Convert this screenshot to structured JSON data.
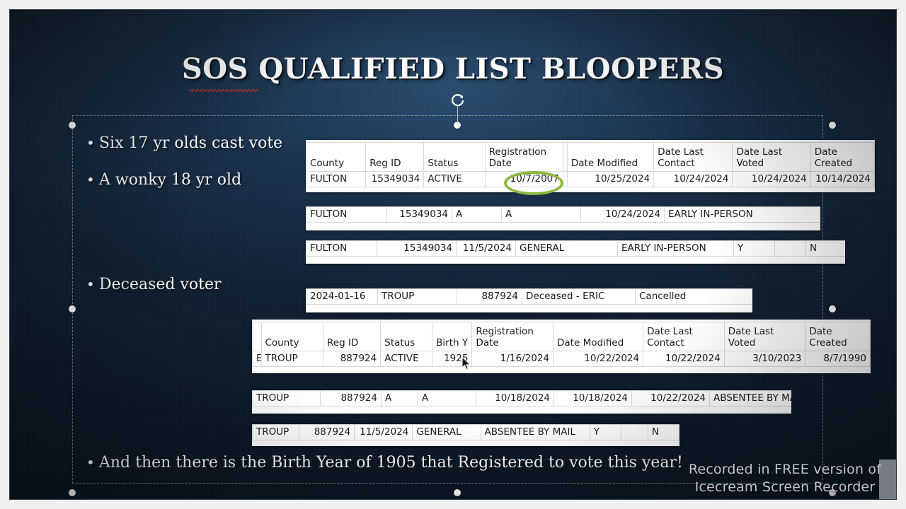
{
  "slide": {
    "title": "SOS QUALIFIED LIST BLOOPERS",
    "bullets": [
      {
        "text": "Six 17 yr olds cast vote"
      },
      {
        "text": "A wonky 18 yr old"
      },
      {
        "text": "Deceased voter"
      },
      {
        "text": "And then there is the Birth Year of 1905 that Registered to vote this year!"
      }
    ],
    "background_color": "#12202f",
    "title_color": "#ffffff",
    "highlight_color": "#8cb83c"
  },
  "sheet1": {
    "headers": [
      "County",
      "Reg ID",
      "Status",
      "Registration Date",
      "",
      "Date Modified",
      "Date Last Contact",
      "Date Last Voted",
      "Date Created"
    ],
    "row": [
      "FULTON",
      "15349034",
      "ACTIVE",
      "10/7/2007",
      "",
      "10/25/2024",
      "10/24/2024",
      "10/24/2024",
      "10/14/2024"
    ]
  },
  "sheet2": {
    "row": [
      "FULTON",
      "15349034",
      "A",
      "A",
      "10/24/2024",
      "EARLY IN-PERSON"
    ]
  },
  "sheet3": {
    "row": [
      "FULTON",
      "15349034",
      "11/5/2024",
      "GENERAL",
      "EARLY IN-PERSON",
      "Y",
      "",
      "N"
    ]
  },
  "sheet4": {
    "row": [
      "2024-01-16",
      "TROUP",
      "887924",
      "Deceased - ERIC",
      "Cancelled"
    ]
  },
  "sheet5": {
    "headers": [
      "",
      "County",
      "Reg ID",
      "Status",
      "Birth Y",
      "Registration Date",
      "Date Modified",
      "Date Last Contact",
      "Date Last Voted",
      "Date Created"
    ],
    "row": [
      "E",
      "TROUP",
      "887924",
      "ACTIVE",
      "1925",
      "1/16/2024",
      "10/22/2024",
      "10/22/2024",
      "3/10/2023",
      "8/7/1990"
    ]
  },
  "sheet6": {
    "row": [
      "TROUP",
      "887924",
      "A",
      "A",
      "10/18/2024",
      "10/18/2024",
      "10/22/2024",
      "ABSENTEE BY MAIL"
    ]
  },
  "sheet7": {
    "row": [
      "TROUP",
      "887924",
      "11/5/2024",
      "GENERAL",
      "ABSENTEE BY MAIL",
      "Y",
      "",
      "N"
    ]
  },
  "watermark": {
    "line1": "Recorded in FREE version of",
    "line2": "Icecream  Screen  Recorder"
  }
}
